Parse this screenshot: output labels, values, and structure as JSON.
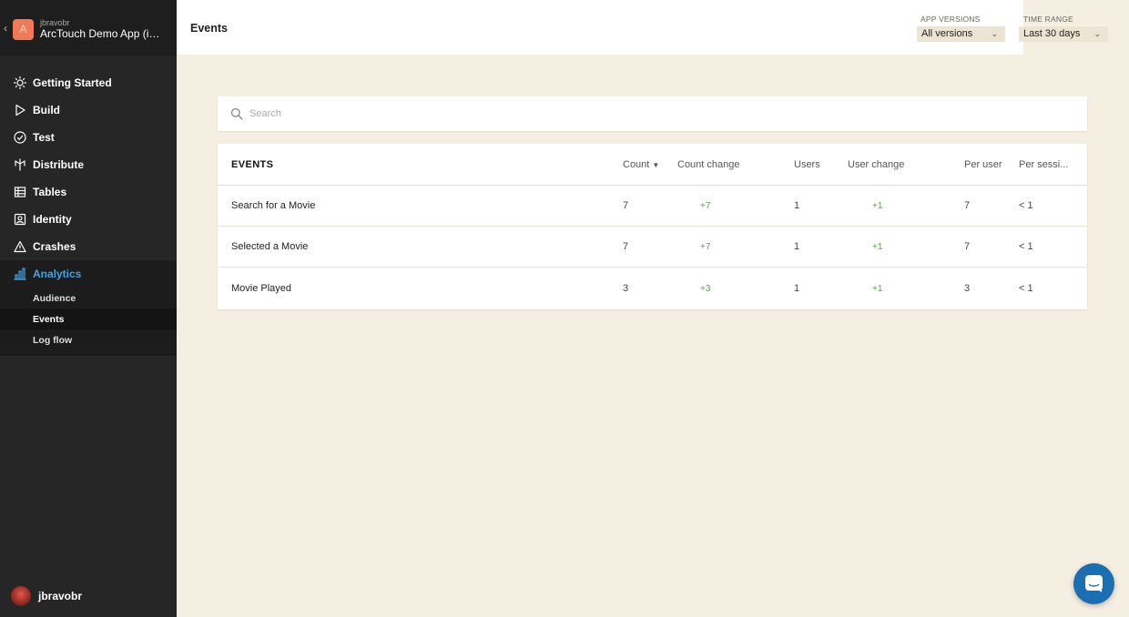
{
  "app": {
    "owner": "jbravobr",
    "name": "ArcTouch Demo App (iOS)",
    "avatar_letter": "A"
  },
  "nav": {
    "items": [
      {
        "label": "Getting Started",
        "icon": "sun-icon"
      },
      {
        "label": "Build",
        "icon": "play-icon"
      },
      {
        "label": "Test",
        "icon": "check-circle-icon"
      },
      {
        "label": "Distribute",
        "icon": "distribute-icon"
      },
      {
        "label": "Tables",
        "icon": "tables-icon"
      },
      {
        "label": "Identity",
        "icon": "identity-icon"
      },
      {
        "label": "Crashes",
        "icon": "warning-icon"
      },
      {
        "label": "Analytics",
        "icon": "bar-chart-icon"
      }
    ],
    "analytics_sub": [
      "Audience",
      "Events",
      "Log flow"
    ]
  },
  "user": {
    "name": "jbravobr"
  },
  "topbar": {
    "title": "Events",
    "app_versions_label": "APP VERSIONS",
    "app_versions_value": "All versions",
    "time_range_label": "TIME RANGE",
    "time_range_value": "Last 30 days"
  },
  "search": {
    "placeholder": "Search"
  },
  "table": {
    "headers": {
      "title": "EVENTS",
      "count": "Count",
      "count_change": "Count change",
      "users": "Users",
      "user_change": "User change",
      "per_user": "Per user",
      "per_session": "Per sessi..."
    },
    "rows": [
      {
        "name": "Search for a Movie",
        "count": "7",
        "count_change": "+7",
        "users": "1",
        "user_change": "+1",
        "per_user": "7",
        "per_session": "< 1"
      },
      {
        "name": "Selected a Movie",
        "count": "7",
        "count_change": "+7",
        "users": "1",
        "user_change": "+1",
        "per_user": "7",
        "per_session": "< 1"
      },
      {
        "name": "Movie Played",
        "count": "3",
        "count_change": "+3",
        "users": "1",
        "user_change": "+1",
        "per_user": "3",
        "per_session": "< 1"
      }
    ]
  },
  "colors": {
    "accent": "#46a3e0",
    "positive": "#5aa24c",
    "sidebar": "#262626",
    "background": "#f5efe1",
    "chat": "#1a6fb3"
  }
}
